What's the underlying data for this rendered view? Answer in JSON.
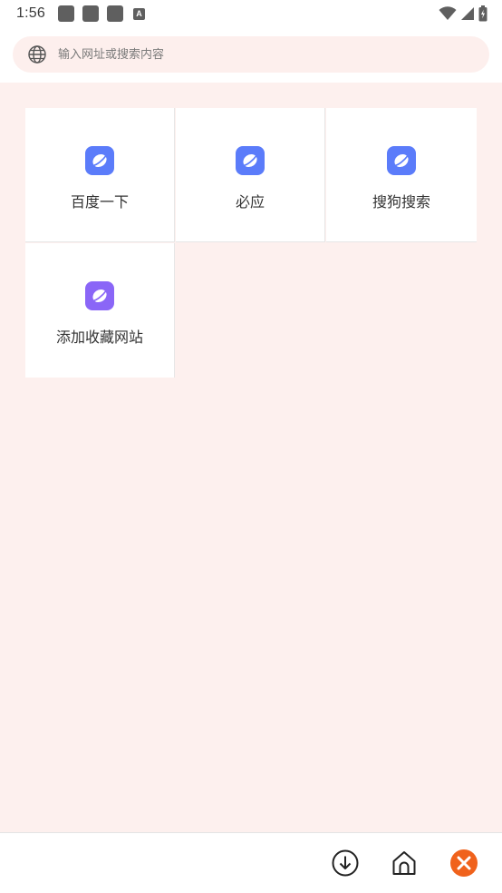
{
  "status_bar": {
    "time": "1:56",
    "notification_badge": "A",
    "icons": [
      "notification-icon",
      "notification-icon",
      "notification-icon",
      "a-icon",
      "wifi-icon",
      "signal-icon",
      "battery-icon"
    ]
  },
  "search": {
    "placeholder": "输入网址或搜索内容",
    "value": "",
    "icon": "globe-icon"
  },
  "bookmarks": [
    {
      "label": "百度一下",
      "icon": "planet-icon",
      "color": "#5b7cfa"
    },
    {
      "label": "必应",
      "icon": "planet-icon",
      "color": "#5b7cfa"
    },
    {
      "label": "搜狗搜索",
      "icon": "planet-icon",
      "color": "#5b7cfa"
    },
    {
      "label": "添加收藏网站",
      "icon": "planet-icon",
      "color": "#8a66f7"
    }
  ],
  "bottom_bar": {
    "buttons": [
      {
        "name": "download",
        "icon": "download-icon"
      },
      {
        "name": "home",
        "icon": "home-icon"
      },
      {
        "name": "close",
        "icon": "close-icon",
        "color": "#f0621c"
      }
    ]
  },
  "colors": {
    "content_bg": "#fdf0ee",
    "search_bg": "#fdefed",
    "accent_blue": "#5b7cfa",
    "accent_purple": "#8a66f7",
    "close_orange": "#f0621c"
  }
}
